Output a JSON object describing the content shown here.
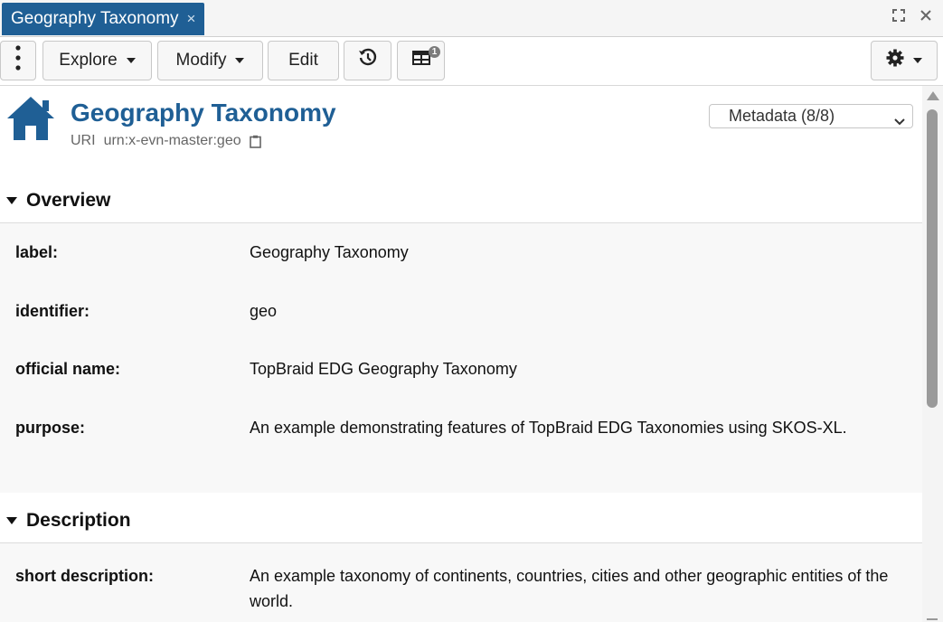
{
  "tab": {
    "title": "Geography Taxonomy",
    "close_icon": "×"
  },
  "toolbar": {
    "menu_icon": "kebab-icon",
    "explore_label": "Explore",
    "modify_label": "Modify",
    "edit_label": "Edit",
    "history_icon": "history-icon",
    "table_icon": "table-icon",
    "table_badge": "1",
    "settings_icon": "gear-icon"
  },
  "header": {
    "icon": "home-icon",
    "title": "Geography Taxonomy",
    "uri_label": "URI",
    "uri_value": "urn:x-evn-master:geo",
    "metadata_select": "Metadata (8/8)"
  },
  "sections": {
    "overview": {
      "title": "Overview",
      "rows": [
        {
          "label": "label:",
          "value": "Geography Taxonomy"
        },
        {
          "label": "identifier:",
          "value": "geo"
        },
        {
          "label": "official name:",
          "value": "TopBraid EDG Geography Taxonomy"
        },
        {
          "label": "purpose:",
          "value": "An example demonstrating features of TopBraid EDG Taxonomies using SKOS-XL."
        }
      ]
    },
    "description": {
      "title": "Description",
      "rows": [
        {
          "label": "short description:",
          "value": "An example taxonomy of continents, countries, cities and other geographic entities of the world."
        }
      ]
    }
  },
  "colors": {
    "accent": "#1f5f95",
    "tab_bg": "#1f5f95",
    "section_bg": "#f8f8f8"
  }
}
